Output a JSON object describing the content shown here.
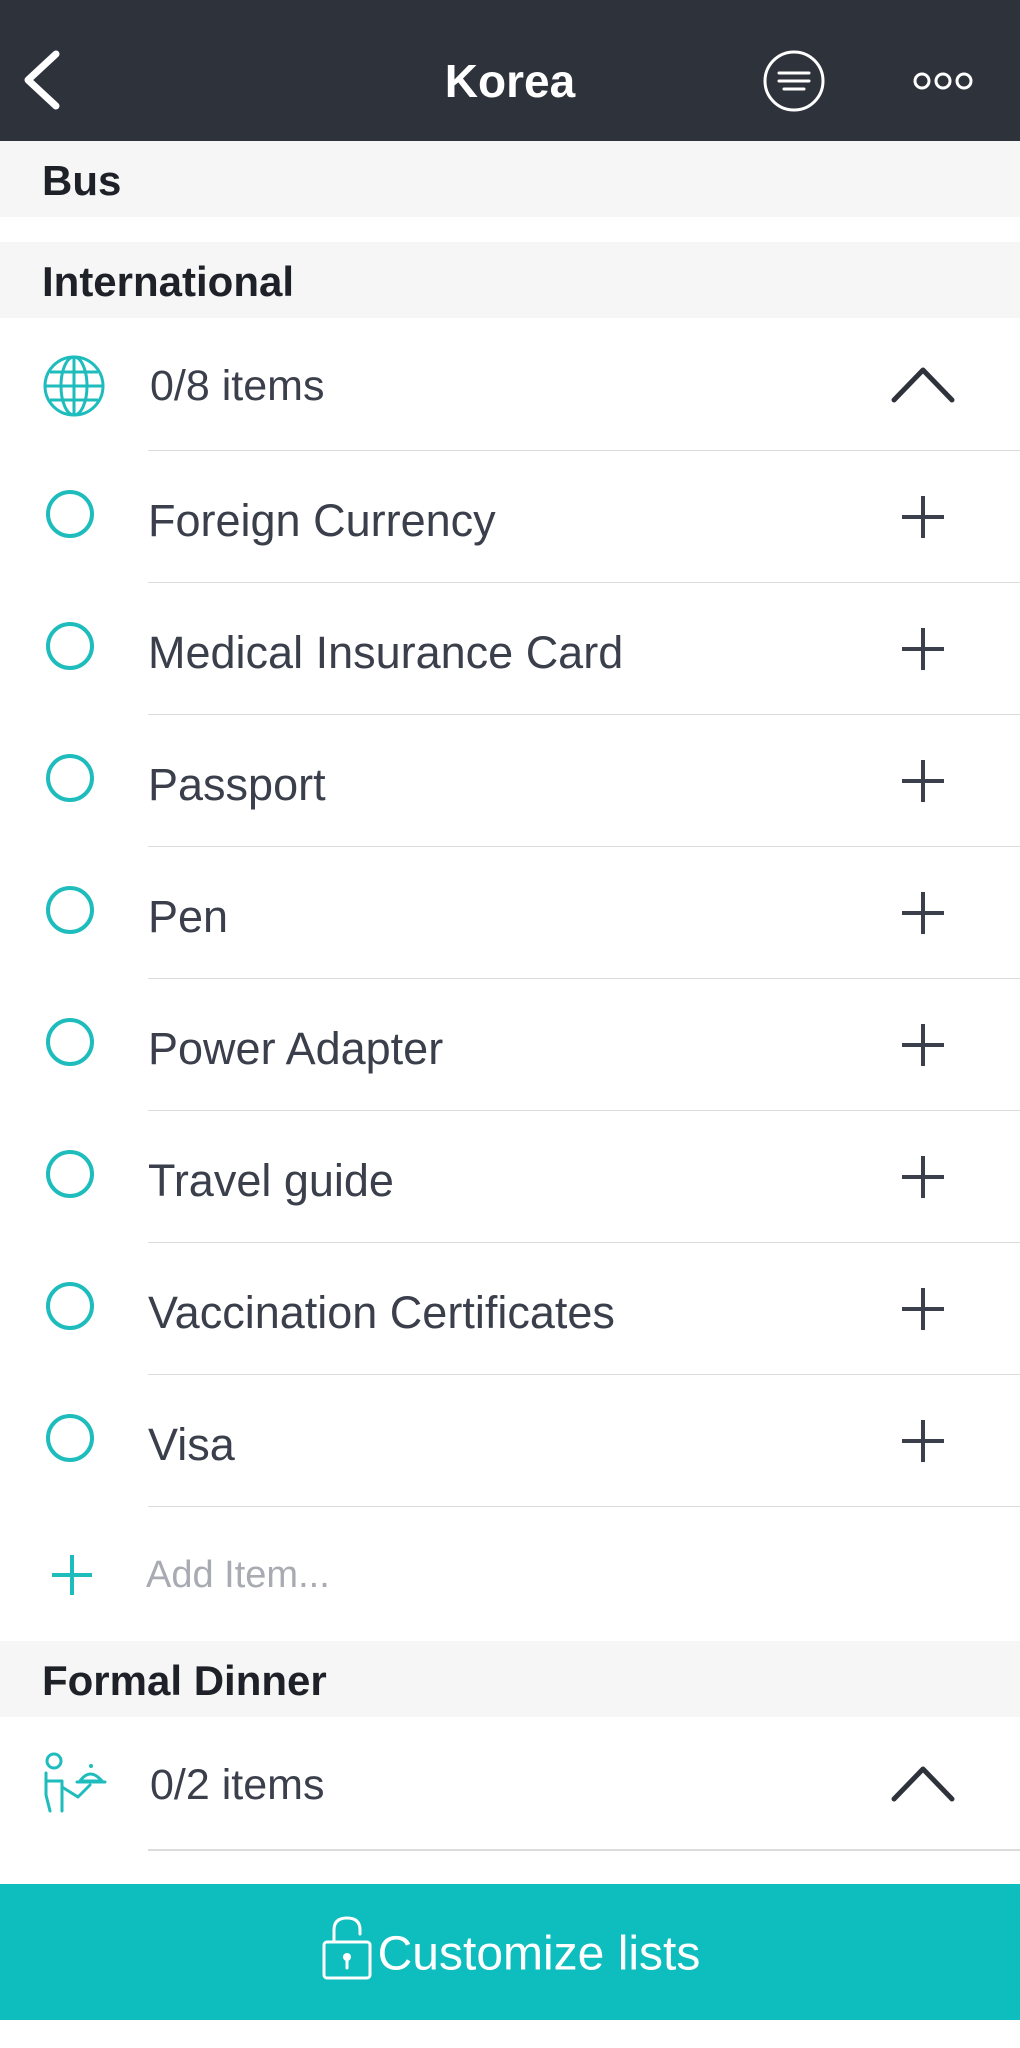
{
  "nav": {
    "title": "Korea",
    "back_icon": "chevron-left-icon",
    "filter_icon": "filter-lines-icon",
    "more_icon": "more-dots-icon"
  },
  "sections": [
    {
      "title": "Bus"
    },
    {
      "title": "International",
      "summary": "0/8 items",
      "icon": "globe-icon",
      "items": [
        "Foreign Currency",
        "Medical Insurance Card",
        "Passport",
        "Pen",
        "Power Adapter",
        "Travel guide",
        "Vaccination Certificates",
        "Visa"
      ],
      "add_placeholder": "Add Item..."
    },
    {
      "title": "Formal Dinner",
      "summary": "0/2 items",
      "icon": "waiter-icon"
    }
  ],
  "bottom": {
    "label": "Customize lists",
    "icon": "unlock-icon"
  },
  "colors": {
    "navbar": "#2e323a",
    "accent": "#1ebcbc",
    "bottom_bar": "#0ebdbd",
    "section_bg": "#f6f6f6"
  }
}
